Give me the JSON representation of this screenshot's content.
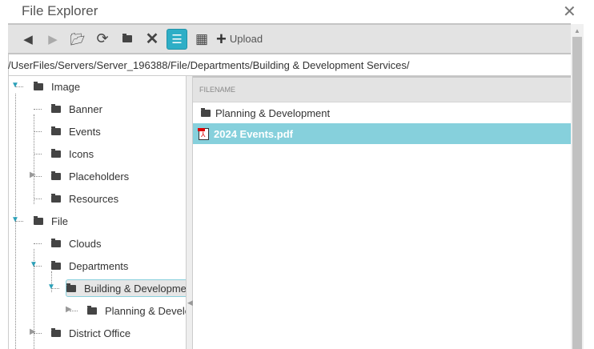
{
  "window": {
    "title": "File Explorer"
  },
  "toolbar": {
    "upload_label": "Upload",
    "plus": "+"
  },
  "path": "/UserFiles/Servers/Server_196388/File/Departments/Building & Development Services/",
  "tree": [
    {
      "label": "Image",
      "level": 0,
      "state": "open"
    },
    {
      "label": "Banner",
      "level": 1,
      "state": "leaf"
    },
    {
      "label": "Events",
      "level": 1,
      "state": "leaf"
    },
    {
      "label": "Icons",
      "level": 1,
      "state": "leaf"
    },
    {
      "label": "Placeholders",
      "level": 1,
      "state": "closed"
    },
    {
      "label": "Resources",
      "level": 1,
      "state": "leaf"
    },
    {
      "label": "File",
      "level": 0,
      "state": "open"
    },
    {
      "label": "Clouds",
      "level": 1,
      "state": "leaf"
    },
    {
      "label": "Departments",
      "level": 1,
      "state": "open"
    },
    {
      "label": "Building & Development Services",
      "level": 2,
      "state": "open",
      "selected": true
    },
    {
      "label": "Planning & Development",
      "level": 3,
      "state": "closed"
    },
    {
      "label": "District Office",
      "level": 1,
      "state": "closed"
    }
  ],
  "list": {
    "header": "FILENAME",
    "items": [
      {
        "name": "Planning & Development",
        "type": "folder"
      },
      {
        "name": "2024 Events.pdf",
        "type": "pdf",
        "selected": true
      }
    ]
  }
}
